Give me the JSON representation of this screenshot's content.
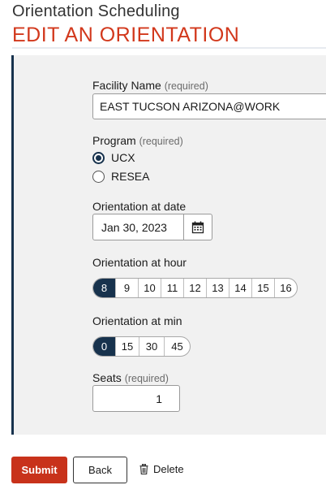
{
  "header": {
    "subtitle": "Orientation Scheduling",
    "title": "EDIT AN ORIENTATION"
  },
  "form": {
    "facility": {
      "label": "Facility Name",
      "required": "(required)",
      "value": "EAST TUCSON ARIZONA@WORK"
    },
    "program": {
      "label": "Program",
      "required": "(required)",
      "options": [
        {
          "label": "UCX",
          "checked": true
        },
        {
          "label": "RESEA",
          "checked": false
        }
      ]
    },
    "date": {
      "label": "Orientation at date",
      "value": "Jan 30, 2023",
      "icon": "calendar-icon"
    },
    "hour": {
      "label": "Orientation at hour",
      "options": [
        "8",
        "9",
        "10",
        "11",
        "12",
        "13",
        "14",
        "15",
        "16"
      ],
      "selected": "8"
    },
    "minute": {
      "label": "Orientation at min",
      "options": [
        "0",
        "15",
        "30",
        "45"
      ],
      "selected": "0"
    },
    "seats": {
      "label": "Seats",
      "required": "(required)",
      "value": "1"
    }
  },
  "actions": {
    "submit": "Submit",
    "back": "Back",
    "delete": "Delete"
  },
  "colors": {
    "brand_red": "#d2381c",
    "navy": "#17324d"
  }
}
